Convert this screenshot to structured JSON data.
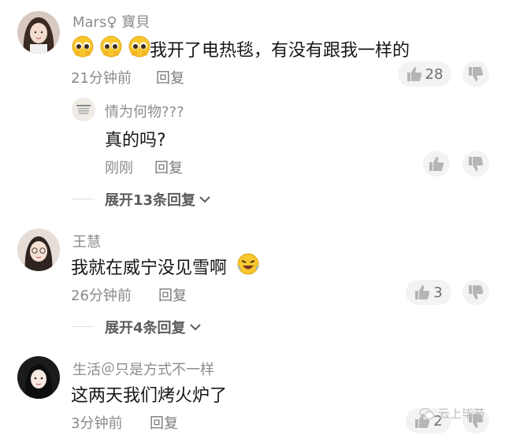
{
  "comments": [
    {
      "username": "Mars♀  寶貝",
      "emojis": [
        "pleading-face-emoji",
        "pleading-face-emoji",
        "pleading-face-emoji"
      ],
      "text": "我开了电热毯，有没有跟我一样的",
      "time": "21分钟前",
      "reply_label": "回复",
      "likes": "28",
      "replies": [
        {
          "username": "情为何物???",
          "text": "真的吗?",
          "time": "刚刚",
          "reply_label": "回复"
        }
      ],
      "expand_label": "展开13条回复"
    },
    {
      "username": "王慧",
      "text": "我就在威宁没见雪啊",
      "time": "26分钟前",
      "reply_label": "回复",
      "likes": "3",
      "expand_label": "展开4条回复"
    },
    {
      "username": "生活＠只是方式不一样",
      "text": "这两天我们烤火炉了",
      "time": "3分钟前",
      "reply_label": "回复",
      "likes": "2"
    }
  ],
  "watermark": "云上毕节",
  "colors": {
    "text": "#161616",
    "meta": "#8a8a8a",
    "button_bg": "#f3f3f3"
  }
}
